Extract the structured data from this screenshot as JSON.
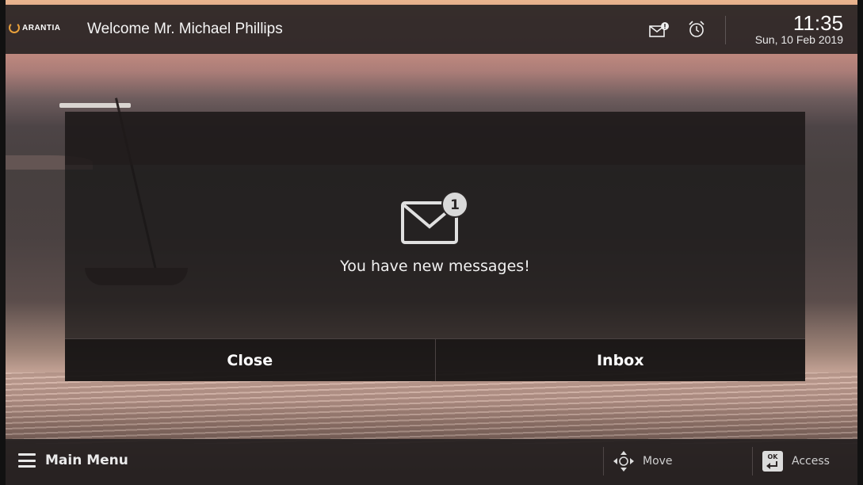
{
  "topbar": {
    "logo_text": "ARANTIA",
    "welcome": "Welcome Mr. Michael Phillips",
    "mail_badge_count": 1,
    "clock_time": "11:35",
    "clock_date": "Sun, 10 Feb 2019"
  },
  "dialog": {
    "badge_count": "1",
    "message": "You have new messages!",
    "close_label": "Close",
    "inbox_label": "Inbox"
  },
  "bottombar": {
    "main_menu_label": "Main Menu",
    "move_label": "Move",
    "access_label": "Access",
    "ok_key_label": "OK"
  },
  "colors": {
    "logo_accent": "#e9a13b",
    "bar_background": "#2c2626",
    "dialog_background": "#181616"
  },
  "icons": [
    "logo-mark",
    "mail-icon",
    "alarm-clock-icon",
    "envelope-icon",
    "hamburger-icon",
    "dpad-icon",
    "ok-enter-icon"
  ]
}
